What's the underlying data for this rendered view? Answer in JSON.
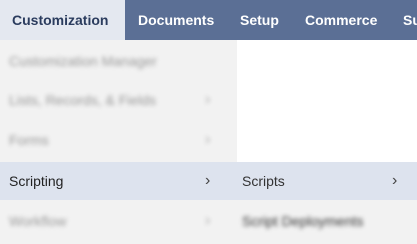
{
  "navbar": {
    "tabs": [
      {
        "label": "Customization"
      },
      {
        "label": "Documents"
      },
      {
        "label": "Setup"
      },
      {
        "label": "Commerce"
      },
      {
        "label": "Su"
      }
    ]
  },
  "menu": {
    "items": [
      {
        "label": "Customization Manager"
      },
      {
        "label": "Lists, Records, & Fields"
      },
      {
        "label": "Forms"
      },
      {
        "label": "Scripting"
      },
      {
        "label": "Workflow"
      }
    ]
  },
  "submenu": {
    "items": [
      {
        "label": "Scripts"
      },
      {
        "label": "Script Deployments"
      }
    ]
  },
  "icons": {
    "chevron": "›"
  },
  "colors": {
    "navbar_bg": "#5b6f95",
    "active_tab_bg": "#e4e8f0",
    "menu_bg": "#f2f2f2",
    "selected_bg": "#dde3ee"
  }
}
